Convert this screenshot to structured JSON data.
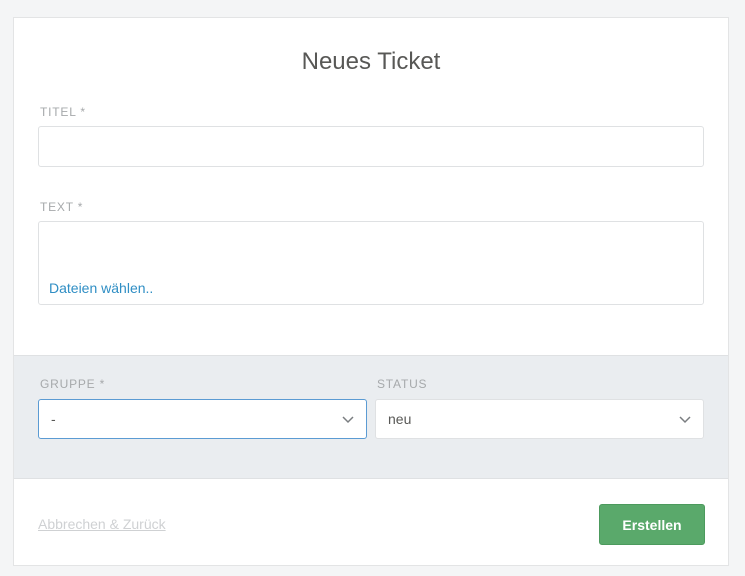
{
  "form": {
    "heading": "Neues Ticket",
    "title_label": "TITEL *",
    "title_value": "",
    "text_label": "TEXT *",
    "text_value": "",
    "file_link": "Dateien wählen.."
  },
  "attributes": {
    "group_label": "GRUPPE *",
    "group_value": "-",
    "status_label": "STATUS",
    "status_value": "neu"
  },
  "actions": {
    "cancel_label": "Abbrechen & Zurück",
    "create_label": "Erstellen"
  },
  "colors": {
    "accent": "#2f8ec4",
    "create_button": "#5aa96b",
    "focus_border": "#5b9bd3",
    "section_bg": "#eaedf0"
  },
  "icons": {
    "select_chevron": "chevron-down-icon"
  }
}
